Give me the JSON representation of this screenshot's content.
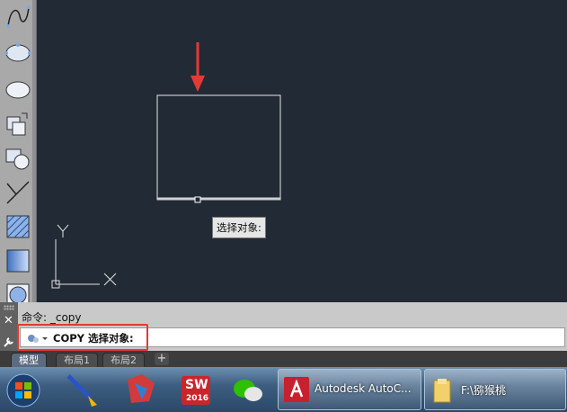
{
  "canvas": {
    "tooltip": "选择对象:",
    "ucs_y": "Y",
    "ucs_x": "X"
  },
  "toolbar": {
    "tools": [
      "spline-icon",
      "ellipse-icon",
      "ellipse-arc-icon",
      "insert-block-icon",
      "create-block-icon",
      "point-icon",
      "hatch-icon",
      "gradient-icon",
      "region-icon"
    ]
  },
  "command_line": {
    "history": "命令: _copy",
    "prompt": "COPY 选择对象:"
  },
  "layout_tabs": [
    "模型",
    "布局1",
    "布局2"
  ],
  "layout_add": "+",
  "taskbar": {
    "autocad_label": "Autodesk AutoC...",
    "folder_label": "F:\\猕猴桃",
    "solidworks_badge": "SW",
    "solidworks_year": "2016"
  },
  "colors": {
    "canvas_bg": "#212a35",
    "highlight": "#e53935",
    "arrow": "#e53935"
  }
}
